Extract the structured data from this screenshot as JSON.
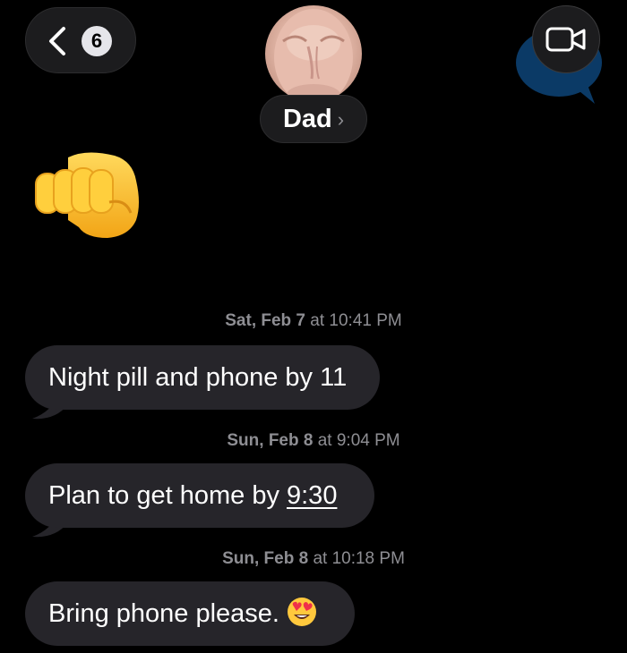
{
  "header": {
    "back_badge_count": "6",
    "contact_name": "Dad",
    "name_chevron": "›",
    "icons": {
      "back": "chevron-left-icon",
      "video": "video-camera-icon",
      "facetime_bubble": "facetime-speech-bubble-icon"
    }
  },
  "messages": [
    {
      "type": "emoji",
      "content": "oncoming-fist-emoji"
    },
    {
      "type": "timestamp",
      "day": "Sat, Feb 7",
      "time": " at 10:41 PM"
    },
    {
      "type": "bubble",
      "text": "Night pill and phone by 11"
    },
    {
      "type": "timestamp",
      "day": "Sun, Feb 8",
      "time": " at 9:04 PM"
    },
    {
      "type": "bubble",
      "text_before": "Plan to get home by ",
      "link_text": "9:30"
    },
    {
      "type": "timestamp",
      "day": "Sun, Feb 8",
      "time": " at 10:18 PM"
    },
    {
      "type": "bubble",
      "text": "Bring phone please.",
      "emoji": "heart-eyes-emoji"
    }
  ],
  "colors": {
    "background": "#000000",
    "incoming_bubble": "#26252a",
    "timestamp_text": "#8e8e93",
    "facetime_accent": "#0b3a66"
  }
}
